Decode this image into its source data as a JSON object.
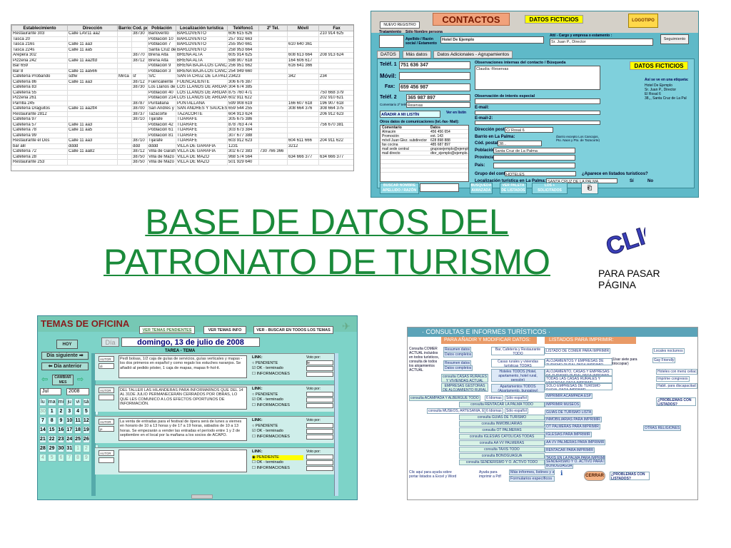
{
  "spreadsheet": {
    "headers": [
      "Establecimiento",
      "Dirección",
      "Barrio",
      "Cod. postal",
      "Población",
      "Localización turística",
      "Teléfono1",
      "2º Tel.",
      "Móvil",
      "Fax"
    ],
    "rows": [
      [
        "Restaurante 303",
        "Calle LAV11 aa2",
        "",
        "38730",
        "Barlovento",
        "BARLOVENTO",
        "606 615 626",
        "",
        "",
        "210 914 625"
      ],
      [
        "Tasca 20",
        "",
        "",
        "",
        "Población 10",
        "BARLOVENTO",
        "257 932 663",
        "",
        "",
        ""
      ],
      [
        "Tasca 216s",
        "Calle 11 aa3",
        "",
        "",
        "Población 7",
        "BARLOVENTO",
        "255 950 661",
        "",
        "610 640 361",
        ""
      ],
      [
        "Tasca 224s",
        "Calle 11 aa5",
        "",
        "",
        "Santa Cruz de La",
        "BARLOVENTO",
        "258 953 664",
        "",
        "",
        ""
      ],
      [
        "Arepera 302",
        "",
        "",
        "38770",
        "Breña Alta",
        "BREÑA ALTA",
        "605 914 625",
        "",
        "608 613 664",
        "208 913 624"
      ],
      [
        "Pizzeria 242",
        "Calle 11 aa2ttd",
        "",
        "38712",
        "Breña Alta",
        "BREÑA ALTA",
        "598 907 618",
        "",
        "164 606 617",
        ""
      ],
      [
        "Bar 659",
        "",
        "",
        "",
        "Población 9",
        "BREÑA BAJA-LOS CANCAJOS",
        "256 951 662",
        "",
        "616 641 366",
        ""
      ],
      [
        "Bar 8",
        "Calle 11 aa566",
        "",
        "",
        "Población 3",
        "BREÑA BAJA-LOS CANCAJOS",
        "254 949 660",
        "",
        "",
        ""
      ],
      [
        "Cafetería Probando",
        "sdfw",
        "Mirca",
        "sf",
        "S/C",
        "SANTA CRUZ DE LA PALMA",
        "23423",
        "",
        "342",
        "234"
      ],
      [
        "Cafetería 86",
        "Calle 11 aa3",
        "",
        "38712",
        "Fuencaliente",
        "FUENCALIENTE",
        "306 676 387",
        "",
        "",
        ""
      ],
      [
        "Cafetería 83",
        "",
        "",
        "38730",
        "Los Llanos de Ar",
        "LOS LLANOS DE ARIDANE",
        "304 674 385",
        "",
        "",
        ""
      ],
      [
        "Cafetería 55",
        "",
        "",
        "",
        "Población 40",
        "LOS LLANOS DE ARIDANE",
        "875 760 471",
        "",
        "",
        "750 668 379"
      ],
      [
        "Pizzeria 261",
        "",
        "",
        "",
        "Población 214",
        "LOS LLANOS DE ARIDANE",
        "602 911 622",
        "",
        "",
        "202 910 621"
      ],
      [
        "Parrilla 245",
        "",
        "",
        "38787",
        "Puntallana",
        "PUNTALLANA",
        "599 908 619",
        "",
        "166 607 618",
        "196 907 618"
      ],
      [
        "Cafetería Draguitos",
        "Calle 11 aa2tt4",
        "",
        "38700",
        "San Andrés y Sa",
        "SAN ANDRÉS Y SAUCES",
        "659 544 255",
        "",
        "308 664 376",
        "308 664 375"
      ],
      [
        "Restaurante 2812",
        "",
        "",
        "38737",
        "Tazacorte",
        "TAZACORTE",
        "604 913 624",
        "",
        "",
        "206 912 623"
      ],
      [
        "Cafetería 97",
        "",
        "",
        "38710",
        "Tijarafe",
        "TIJARAFE",
        "305 675 386",
        "",
        "",
        ""
      ],
      [
        "Cafetería 57",
        "Calle 11 aa3",
        "",
        "",
        "Población 42",
        "TIJARAFE",
        "878 763 474",
        "",
        "",
        "756 670 381"
      ],
      [
        "Cafetería 78",
        "Calle 11 aa5",
        "",
        "",
        "Población 61",
        "TIJARAFE",
        "303 673 384",
        "",
        "",
        ""
      ],
      [
        "Cafetería 99",
        "",
        "",
        "",
        "Población 81",
        "TIJARAFE",
        "307 677 388",
        "",
        "",
        ""
      ],
      [
        "Restaurante el Dos",
        "Calle 11 aa3",
        "",
        "38710",
        "Tijarafe",
        "TIJARAFE",
        "603 912 623",
        "",
        "604 611 666",
        "204 911 622"
      ],
      [
        "bar alil",
        "dddd",
        "",
        "ddd",
        "dddd",
        "VILLA DE GARAFÍA",
        "1231",
        "",
        "3212",
        ""
      ],
      [
        "Cafetería 72",
        "Calle 11 aa82",
        "",
        "38712",
        "Villa de Garafía",
        "VILLA DE GARAFÍA",
        "302 672 383",
        "730 766 366",
        "",
        ""
      ],
      [
        "Cafetería 28",
        "",
        "",
        "38750",
        "Villa de Mazo",
        "VILLA DE MAZO",
        "968 574 564",
        "",
        "634 666 377",
        "634 666 377"
      ],
      [
        "Restaurante 253",
        "",
        "",
        "38750",
        "Villa de Mazo",
        "VILLA DE MAZO",
        "501 929 640",
        "",
        "",
        ""
      ]
    ]
  },
  "contactos": {
    "title": "CONTACTOS",
    "fictitious_badge": "DATOS FICTICIOS",
    "logo": "LOGOTIPO",
    "nuevo_registro": "NUEVO REGISTRO",
    "tratamiento_label": "Tratamiento",
    "solo_label": "Sólo Nombre persona",
    "apellido_label": "Apellido / Razón social / Estamento",
    "para_nombres_label": "(para nombres e instituciones)",
    "razon_value": "Hotel De Ejemplo",
    "att_label": "Att/ - Cargo y empresa o estamento :",
    "att_value": "Sr. Juan P., Director",
    "seguimiento": "Seguimiento",
    "tabs": [
      "DATOS",
      "Más datos",
      "Datos Adicionales - Agrupamientos"
    ],
    "telf1_label": "Teléf. 1",
    "telf1": "751 636 347",
    "movil_label": "Móvil:",
    "fax_label": "Fax:",
    "fax": "659 456 987",
    "telf2_label": "Teléf. 2",
    "telf2": "365 987 897",
    "comentario2_label": "Comentario 2º teléf.:",
    "comentario2": "Reservas",
    "anadir_boletin": "AÑADIR A MI LISTÍN TELEFÓNICO",
    "ver_listin": "Ver en listín",
    "otros_label": "Otros datos de comunicaciones (tel.-fax- Mail):",
    "otros_cols": [
      "Comentario",
      "Datos"
    ],
    "otros_rows": [
      [
        "Almacén",
        "456 456 654"
      ],
      [
        "Promoción",
        "ext. 143"
      ],
      [
        "móvil Juan Glez. subdirector",
        "628 898 888"
      ],
      [
        "fax cocina",
        "485 687 897"
      ],
      [
        "mail sede central",
        "gruposejemplo@ejemplo.com"
      ],
      [
        "mail directo",
        "dtor_ejemplo@ejemplo.com"
      ]
    ],
    "obs_label": "Observaciones internas del contacto / Búsqueda",
    "obs_value": "Claudia -Reservas",
    "obs_interes_label": "Observación de interés especial",
    "email_label": "E-mail:",
    "email2_label": "E-mail-2:",
    "direccion_label": "Dirección postal:",
    "direccion": "C/ Rosal 6",
    "barrio_label": "Barrio en La Palma:",
    "cod_postal_label": "Cód. postal:",
    "cod_postal": "38...",
    "poblacion_label": "Población:",
    "poblacion": "Santa Cruz de La Palma",
    "provincia_label": "Provincia:",
    "pais_label": "País:",
    "barrio_note": "(barrio excepto Los Cancajos, Pto. Naos y Pto. de Tazacorte)",
    "datos_ficticios_panel": "DATOS FICTICIOS",
    "etiqueta_label": "Así se ve en una etiqueta:",
    "etiqueta_lines": [
      "Hotel De Ejemplo",
      "Sr. Juan P., Director",
      "El Rosal 6",
      "38,,, Santa Cruz de La Pal"
    ],
    "grupo_label": "Grupo del contacto:",
    "grupo": "HOTELES",
    "aparece_label": "¿Aparece en listados turísticos?",
    "localizacion_label": "Localización turística en La Palma:",
    "localizacion": "SANTA CRUZ DE LA PALMA",
    "si": "Sí",
    "no": "No",
    "buscar_nombre": "BUSCAR NOMBRE APELLIDO / RAZÓN",
    "busqueda_avanzada": "BÚSQUEDA AVANZADA",
    "ver_paleta": "VER PALETA DE LISTADOS",
    "solicitados": "LOS + SOLICITADOS CENTRALITA"
  },
  "main_title": {
    "line1": "BASE DE DATOS DEL",
    "line2": "PATRONATO DE TURISMO"
  },
  "clic": {
    "label": "CLIC",
    "caption_line1": "PARA PASAR",
    "caption_line2": "PÁGINA"
  },
  "temas": {
    "title": "TEMAS DE OFICINA",
    "header_buttons": [
      "VER TEMAS PENDIENTES",
      "VER TEMAS INFO",
      "VER - BUSCAR EN TODOS LOS TEMAS"
    ],
    "hoy": "HOY",
    "dia_label": "Día",
    "date": "domingo, 13 de julio de 2008",
    "tarea_header": "TAREA - TEMA",
    "dia_siguiente": "Día siguiente",
    "dia_anterior": "Día anterior",
    "cambiar_mes": "CAMBIAR MES",
    "month": "Jul",
    "year": "2008",
    "weekdays": [
      "lu",
      "ma",
      "mi",
      "ju",
      "vi",
      "sá",
      "do"
    ],
    "calendar": [
      [
        "30",
        "1",
        "2",
        "3",
        "4",
        "5",
        "6"
      ],
      [
        "7",
        "8",
        "9",
        "10",
        "11",
        "12",
        "13"
      ],
      [
        "14",
        "15",
        "16",
        "17",
        "18",
        "19",
        "20"
      ],
      [
        "21",
        "22",
        "23",
        "24",
        "25",
        "26",
        "27"
      ],
      [
        "28",
        "29",
        "30",
        "31",
        "1",
        "2",
        "3"
      ],
      [
        "4",
        "5",
        "6",
        "7",
        "8",
        "9",
        "10"
      ]
    ],
    "autor_label": "AUTOR",
    "link_label": "LINK:",
    "voto_label": "Voto por:",
    "opt_pendiente": "PENDIENTE",
    "opt_ok": "OK - terminado",
    "opt_info": "INFORMACIONES",
    "tasks": [
      {
        "autor": "di",
        "text": "Pedí bolsas, 1/2 caja de guías de servicios, guías verticales y mapas - los dos primeros en español y como regalo los estuches naranjos. Se añadió al pedido póster, 1 caja de mapas, mapas fr-hol-it.",
        "voto": "le"
      },
      {
        "autor": "",
        "text": "DEL TALLER LAS HILANDERAS PARA INFORMARNOS QUE DEL 14 AL 31DE JULIO PERMANECERÁN CERRADOS POR OBRAS, LO QUE LES COMUNICO A LOS EFECTOS OPORTUNOS DE INFORMACIÓN.",
        "voto": ""
      },
      {
        "autor": "je",
        "text": "La venta de entradas para el festival de ópera será de lunes a viernes en horario de 10 a 13 horas y de 17 a 19 horas, sábados de 10 a 13 horas. Se empezarán a vender las entradas el período entre 1 y 2 de septiembre en el local por la mañana a los socios de ACAPO.",
        "voto": ""
      },
      {
        "autor": "",
        "text": "",
        "voto": ""
      }
    ]
  },
  "consultas": {
    "title": "CONSULTAS E INFORMES TURÍSTICOS",
    "sub_left": "PARA AÑADIR Y MODIFICAR DATOS:",
    "sub_right": "LISTADOS PARA IMPRIMIR:",
    "left_note": "Consulta COMER ACTUAL incluidos en todos turísticos, consulta de todos los alojamientos ACTUAL",
    "links_mid": [
      "Resumen datos",
      "Datos completos",
      "Resumen datos",
      "Datos completos",
      "consulta CASAS RURALES Y VIVIENDAS ACTUAL",
      "EMPRESAS GESTORAS DE ALOJAMIENTO RURAL",
      "consulta ACAMPADA Y ALBERGUE TODO",
      "consulta RENTACAR LA PALMA TODO",
      "consulta MUSEOS, ARTESANÍA, ETC. TODO",
      "consulta GUÍAS DE TURISMO",
      "consulta INMOBILIARIAS",
      "consulta OT PALMERAS",
      "consulta IGLESIAS CATÓLICAS TODAS",
      "consulta AA VV PALMERAS",
      "consulta TAXIS TODO",
      "consulta BONOGUAGUA",
      "consulta SENDERISMO Y O. ACTIVO TODO"
    ],
    "bar_label": "Bar, Cafetería y Restaurante TODO",
    "casas_label": "Casas rurales y viviendas turísticas TODAS",
    "hoteles_label": "Hoteles TODOS (Hotel, apartamento, hotel rural, pensión)",
    "apartamentos_label": "Apartamentos TODOS (Apartamento, bungalow)",
    "idiomas": "6 Idiomas",
    "solo_espanol": "Sólo español",
    "right_links": [
      "LISTADO DE COMER PARA IMPRIMIR",
      "ALOJAMIENTOS Y EMPRESAS DE TURISMO RURAL PARA IMPRIMIR",
      "ALOJAMIENTO, CASAS Y EMPRESAS DE TURISMO RURAL PARA IMPRIMIR",
      "TODAS LAS CASAS RURALES Y VIVIENDAS PARA IMPRIMIR",
      "SÓLO EMPRESAS DE TURISMO RURAL PARA IMPRIMIR",
      "IMPRIMIR ACAMPADA ESP",
      "IMPRIMIR MUSEOS",
      "GUÍAS DE TURISMO LISTA",
      "INMOBILIARIAS PARA IMPRIMIR",
      "OT PALMERAS PARA IMPRIMIR",
      "IGLESIAS PARA IMPRIMIR",
      "AA VV PALMERAS PARA IMPRIMIR",
      "RENTACAR PARA IMPRIMIR",
      "TAXIS EN LA PALMA PARA IMPRIMIR",
      "BONOGUAGUA",
      "SENDERISMO Y O. ACTIVO PARA IMPRIMIR"
    ],
    "far_right": [
      "Locales nocturnos",
      "Gay Friendly",
      "Hoteles con menú celiac",
      "Imprime congresos",
      "Habit. para discapacitad",
      "¿PROBLEMAS CON LISTADOS?",
      "OTRAS RELIGIONES"
    ],
    "usar_siete": "(Usar siete para fotocopiar)",
    "bottom_note": "Clic aquí para ayuda sobre portar listados a Excel y Word",
    "ayuda": "Ayuda para imprimir a Pdf",
    "mas_informes": "Más informes, listines y ayuda",
    "formularios": "Formularios específicos",
    "cerrar": "CERRAR",
    "problemas": "¿PROBLEMAS CON LISTADOS?"
  }
}
